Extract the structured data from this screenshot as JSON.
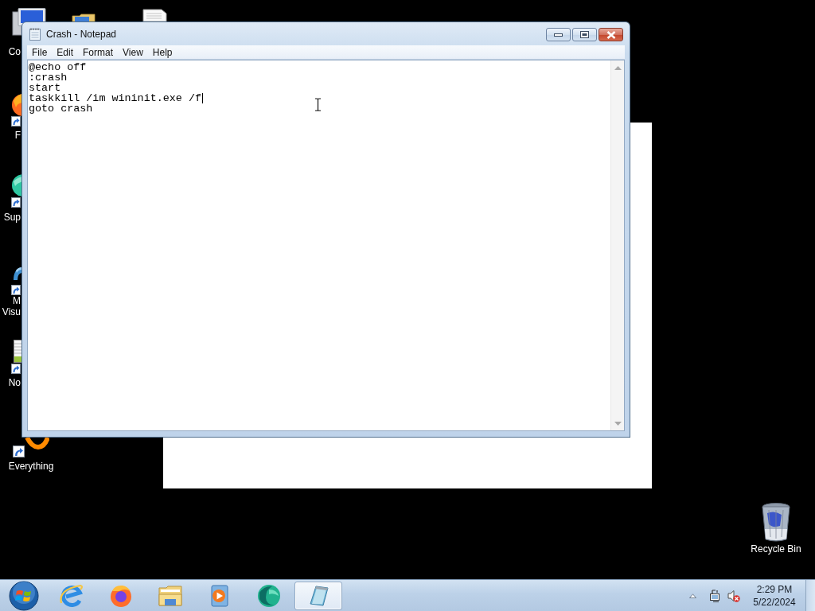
{
  "desktop": {
    "icons": [
      {
        "kind": "monitor",
        "lines": [
          "Co"
        ]
      },
      {
        "kind": "flame",
        "lines": [
          "F"
        ]
      },
      {
        "kind": "sphere",
        "lines": [
          "Sup"
        ]
      },
      {
        "kind": "ribbon",
        "lines": [
          "M",
          "Visu"
        ]
      },
      {
        "kind": "notepad",
        "lines": [
          "No"
        ]
      },
      {
        "kind": "ring",
        "lines": [
          "Everything"
        ]
      },
      {
        "kind": "bin",
        "lines": [
          "Recycle Bin"
        ]
      }
    ]
  },
  "window": {
    "title": "Crash - Notepad",
    "menu": [
      "File",
      "Edit",
      "Format",
      "View",
      "Help"
    ],
    "lines": [
      {
        "text": "@echo off",
        "caret": false
      },
      {
        "text": ":crash",
        "caret": false
      },
      {
        "text": "start",
        "caret": false
      },
      {
        "text": "taskkill /im wininit.exe /f",
        "caret": true
      },
      {
        "text": "goto crash",
        "caret": false
      }
    ]
  },
  "taskbar": {
    "pinned": [
      {
        "kind": "ebrowser",
        "selected": false
      },
      {
        "kind": "foxbrowser",
        "selected": false
      },
      {
        "kind": "folder",
        "selected": false
      },
      {
        "kind": "player",
        "selected": false
      },
      {
        "kind": "sphere",
        "selected": false
      },
      {
        "kind": "notepad",
        "selected": true
      }
    ],
    "tray": {
      "muted": true,
      "time": "2:29 PM",
      "date": "5/22/2024"
    }
  }
}
